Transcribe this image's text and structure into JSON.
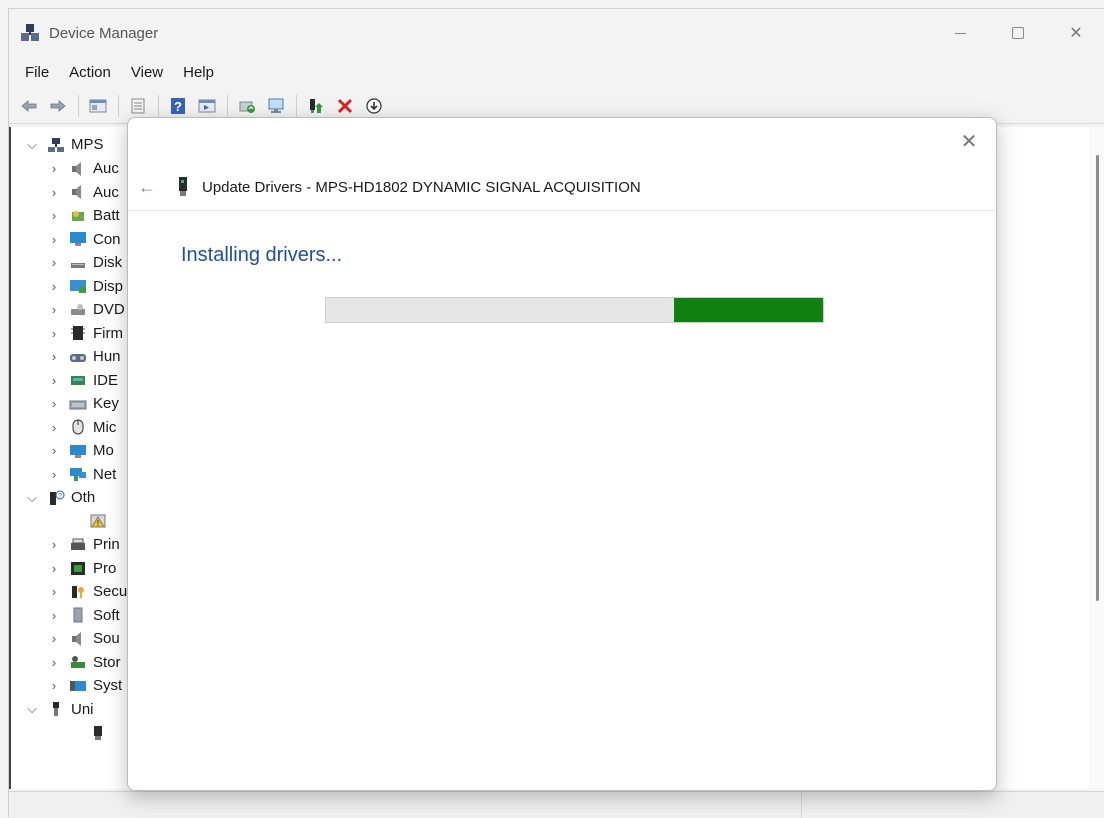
{
  "window": {
    "title": "Device Manager",
    "controls": {
      "minimize": "—",
      "maximize": "☐",
      "close": "✕"
    }
  },
  "menu": [
    "File",
    "Action",
    "View",
    "Help"
  ],
  "toolbar": {
    "icons": [
      "back-arrow-icon",
      "forward-arrow-icon",
      "show-hide-tree-icon",
      "properties-icon",
      "help-icon",
      "view-icon",
      "update-driver-icon",
      "scan-hardware-icon",
      "enable-device-icon",
      "uninstall-icon",
      "download-icon"
    ]
  },
  "tree": {
    "root": "MPS",
    "items": [
      {
        "label": "Auc",
        "expanded": false
      },
      {
        "label": "Auc",
        "expanded": false
      },
      {
        "label": "Batt",
        "expanded": false
      },
      {
        "label": "Con",
        "expanded": false
      },
      {
        "label": "Disk",
        "expanded": false
      },
      {
        "label": "Disp",
        "expanded": false
      },
      {
        "label": "DVD",
        "expanded": false
      },
      {
        "label": "Firm",
        "expanded": false
      },
      {
        "label": "Hun",
        "expanded": false
      },
      {
        "label": "IDE",
        "expanded": false
      },
      {
        "label": "Key",
        "expanded": false
      },
      {
        "label": "Mic",
        "expanded": false
      },
      {
        "label": "Mo",
        "expanded": false
      },
      {
        "label": "Net",
        "expanded": false
      },
      {
        "label": "Oth",
        "expanded": true
      },
      {
        "label": "",
        "child": true
      },
      {
        "label": "Prin",
        "expanded": false
      },
      {
        "label": "Pro",
        "expanded": false
      },
      {
        "label": "Secu",
        "expanded": false
      },
      {
        "label": "Soft",
        "expanded": false
      },
      {
        "label": "Sou",
        "expanded": false
      },
      {
        "label": "Stor",
        "expanded": false
      },
      {
        "label": "Syst",
        "expanded": false
      },
      {
        "label": "Uni",
        "expanded": true
      },
      {
        "label": "",
        "child": true
      }
    ]
  },
  "dialog": {
    "close": "✕",
    "back": "←",
    "title": "Update Drivers - MPS-HD1802 DYNAMIC SIGNAL ACQUISITION",
    "heading": "Installing drivers...",
    "progress": {
      "fill_start": 0.7,
      "fill_end": 1.0,
      "color": "#108010"
    }
  }
}
